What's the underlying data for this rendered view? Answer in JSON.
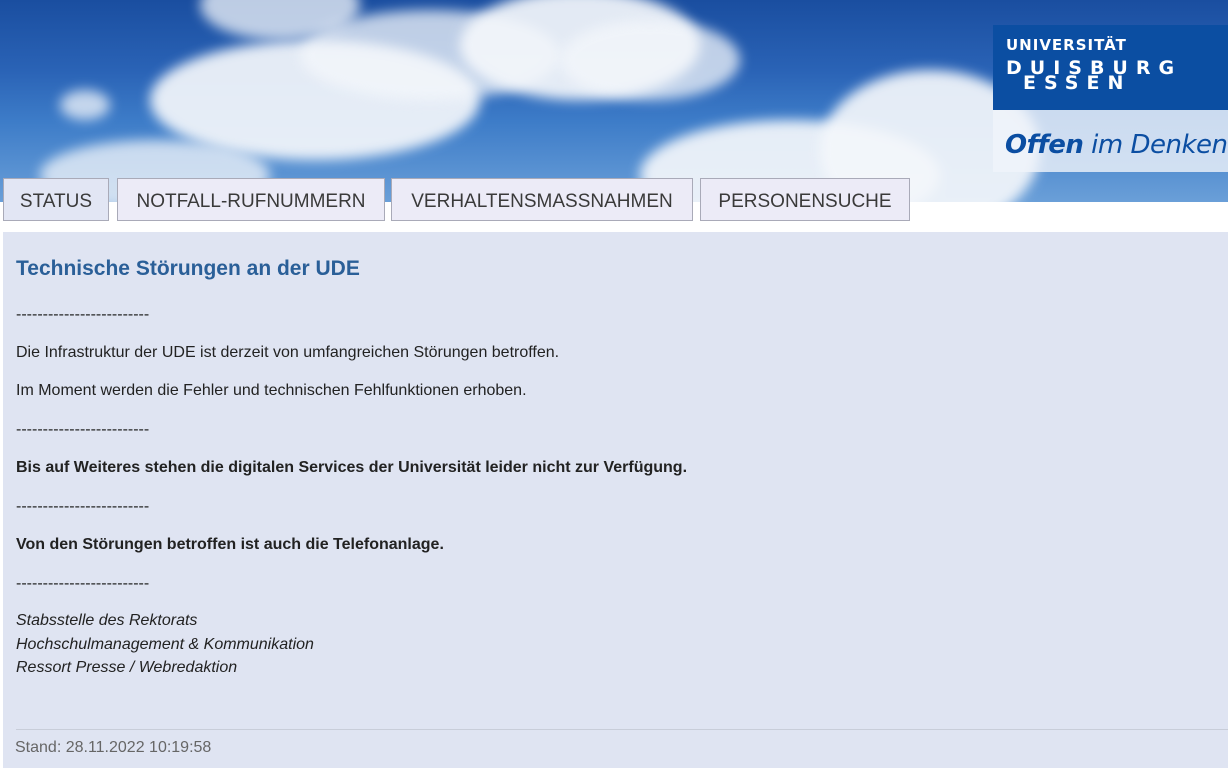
{
  "header": {
    "logo": {
      "line1": "UNIVERSITÄT",
      "line2": "DUISBURG",
      "line3": "ESSEN"
    },
    "slogan_bold": "Offen",
    "slogan_rest": " im Denken"
  },
  "tabs": [
    {
      "label": "STATUS"
    },
    {
      "label": "NOTFALL-RUFNUMMERN"
    },
    {
      "label": "VERHALTENSMASSNAHMEN"
    },
    {
      "label": "PERSONENSUCHE"
    }
  ],
  "content": {
    "title": "Technische Störungen an der UDE",
    "separator": "-------------------------",
    "para1": "Die Infrastruktur der UDE ist derzeit von umfangreichen Störungen betroffen.",
    "para2": "Im Moment werden die Fehler und technischen Fehlfunktionen erhoben.",
    "notice1": "Bis auf Weiteres stehen die digitalen Services der Universität leider nicht zur Verfügung.",
    "notice2": "Von den Störungen betroffen ist auch die Telefonanlage.",
    "signature": [
      "Stabsstelle des Rektorats",
      "Hochschulmanagement & Kommunikation",
      "Ressort Presse / Webredaktion"
    ]
  },
  "footer": {
    "stand": "Stand: 28.11.2022 10:19:58"
  },
  "colors": {
    "title": "#2a5f98",
    "panel_bg": "#dfe4f2",
    "tab_bg": "#ecebf7",
    "logo_blue": "#0b4ea2"
  }
}
